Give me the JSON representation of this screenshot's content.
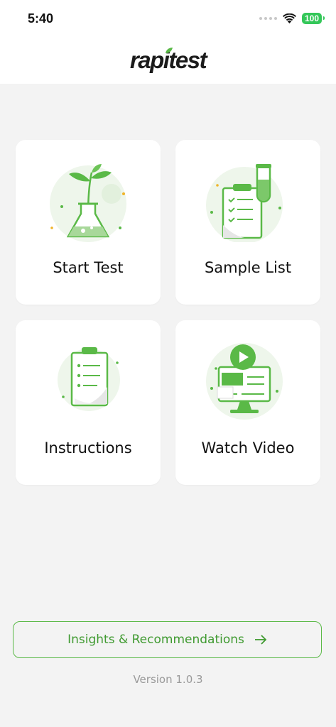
{
  "status_bar": {
    "time": "5:40",
    "battery": "100"
  },
  "header": {
    "logo_text": "rapitest"
  },
  "tiles": [
    {
      "label": "Start Test",
      "icon": "flask-plant-icon"
    },
    {
      "label": "Sample List",
      "icon": "clipboard-test-tube-icon"
    },
    {
      "label": "Instructions",
      "icon": "clipboard-checklist-icon"
    },
    {
      "label": "Watch Video",
      "icon": "monitor-play-icon"
    }
  ],
  "insights_button": {
    "label": "Insights & Recommendations",
    "icon": "arrow-right-icon"
  },
  "version": "Version 1.0.3",
  "colors": {
    "accent_green": "#5ab947",
    "dark_green": "#3f9a30",
    "light_green": "#e9f5e4",
    "background": "#f3f3f3"
  }
}
